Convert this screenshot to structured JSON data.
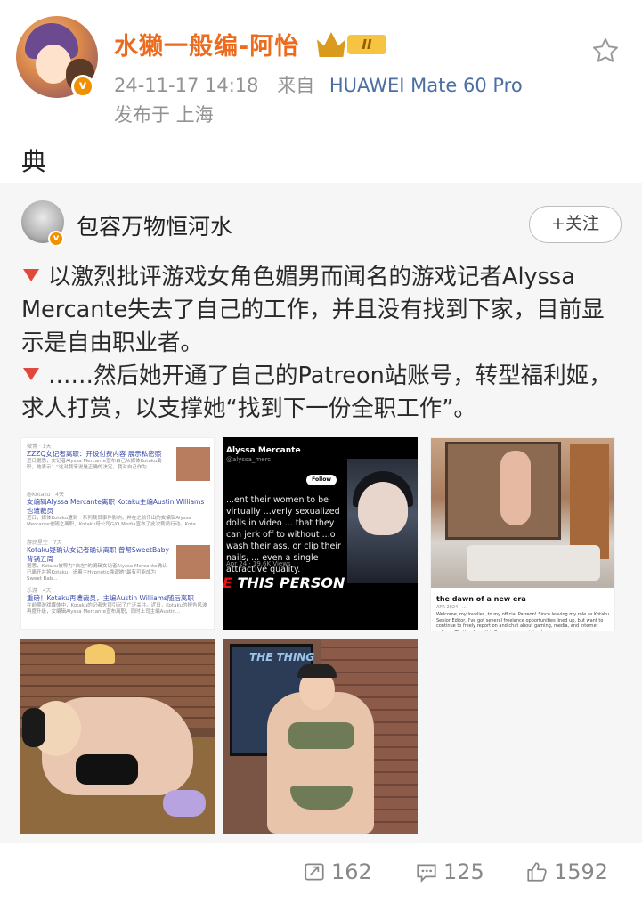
{
  "post": {
    "author": "水獭一般编-阿怡",
    "level_badge": "II",
    "timestamp": "24-11-17 14:18",
    "from_label": "来自",
    "device": "HUAWEI Mate 60 Pro",
    "location": "发布于 上海",
    "text": "典"
  },
  "repost": {
    "author": "包容万物恒河水",
    "follow_label": "+关注",
    "paragraph1": "以激烈批评游戏女角色媚男而闻名的游戏记者Alyssa Mercante失去了自己的工作，并且没有找到下家，目前显示是自由职业者。",
    "paragraph2": "……然后她开通了自己的Patreon站账号，转型福利姬，求人打赏，以支撑她“找到下一份全职工作”。",
    "images": {
      "news": {
        "items": [
          {
            "src": "微博 · 1天",
            "title": "ZZZQ女记者离职：开设付费内容 展示私密照",
            "body": "近日据悉，女记者Alyssa Mercante宣布自己从媒体Kotaku离职，她表示：“这对我来说是正确的决定，我对自己作为..."
          },
          {
            "src": "@Kotaku · 4天",
            "title": "女编辑Alyssa Mercante离职 Kotaku主编Austin Williams也遭裁员",
            "body": "近日，媒体Kotaku遭到一系列裁员事件影响，并在之前传出的女编辑Alyssa Mercante也随之离职，Kotaku母公司G/O Media宣布了此次裁员行动。Kota..."
          },
          {
            "src": "游民星空 · 7天",
            "title": "Kotaku疑确认女记者确认离职 曾帮SweetBaby背锅五周",
            "body": "据悉，Kotaku被称为“白左”的编辑女记者Alyssa Mercante确认已离开并将Kotaku，追着主Hypnotic强调她“最有可能成为Sweet Bab..."
          },
          {
            "src": "乐游 · 4天",
            "title": "重磅！Kotaku再遭裁员，主编Austin Williams随后离职",
            "body": "在前期游戏媒体中，Kotaku的记者失误引起了广泛关注。近日，Kotaku的报告风波再度升级，女编辑Alyssa Mercante宣布离职，同时上司主编Austin..."
          }
        ]
      },
      "tweet": {
        "name": "Alyssa Mercante",
        "handle": "@alyssa_merc",
        "follow": "Follow",
        "body": "...ent their women to be virtually ...verly sexualized dolls in video ... that they can jerk off to without ...o wash their ass, or clip their nails, ... even a single attractive quality.",
        "date": "Apr 24 · 19.6K Views",
        "banner_red": "E",
        "banner_white": " THIS PERSON"
      },
      "patreon": {
        "title": "the dawn of a new era",
        "date": "APR 2024 · ...",
        "body": "Welcome, my lovelies, to my official Patreon! Since leaving my role as Kotaku Senior Editor, I've got several freelance opportunities lined up, but want to continue to freely report on and chat about gaming, media, and internet culture. That's where this Patreon comes into play!"
      },
      "poster_text": "THE THING"
    }
  },
  "actions": {
    "reposts": "162",
    "comments": "125",
    "likes": "1592"
  }
}
